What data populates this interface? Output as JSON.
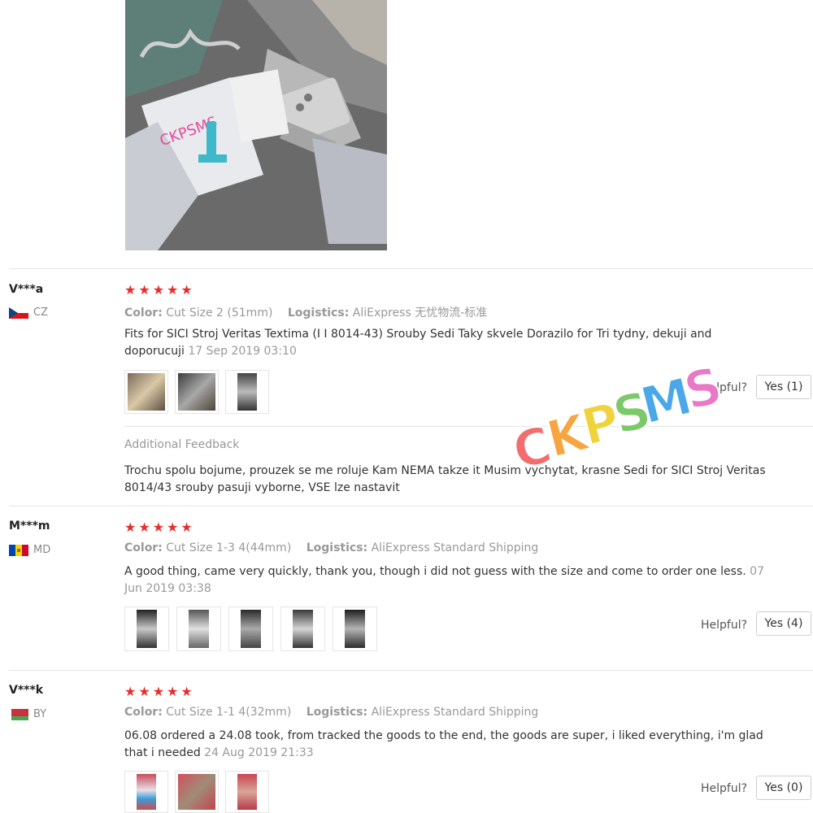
{
  "top_image": {
    "alt_icon": "product-photo"
  },
  "reviews": [
    {
      "user": "V***a",
      "country": "CZ",
      "flag_colors": [
        "#ffffff",
        "#d7141a",
        "#11457e"
      ],
      "stars": 5,
      "color_label": "Color:",
      "color_value": "Cut Size 2 (51mm)",
      "logistics_label": "Logistics:",
      "logistics_value": "AliExpress 无忧物流-标准",
      "text": "Fits for SICI Stroj Veritas Textima (I I 8014-43) Srouby Sedi Taky skvele Dorazilo for Tri tydny, dekuji and doporucuji",
      "date": "17 Sep 2019 03:10",
      "thumb_count": 3,
      "helpful_label": "Helpful?",
      "yes_label": "Yes (1)",
      "additional_title": "Additional Feedback",
      "additional_text": "Trochu spolu bojume, prouzek se me roluje Kam NEMA takze it Musim vychytat, krasne Sedi for SICI Stroj Veritas 8014/43 srouby pasuji vyborne, VSE lze nastavit"
    },
    {
      "user": "M***m",
      "country": "MD",
      "flag_colors": [
        "#0046ae",
        "#ffd200",
        "#cc092f"
      ],
      "stars": 5,
      "color_label": "Color:",
      "color_value": "Cut Size 1-3 4(44mm)",
      "logistics_label": "Logistics:",
      "logistics_value": "AliExpress Standard Shipping",
      "text": "A good thing, came very quickly, thank you, though i did not guess with the size and come to order one less.",
      "date": "07 Jun 2019 03:38",
      "thumb_count": 5,
      "helpful_label": "Helpful?",
      "yes_label": "Yes (4)"
    },
    {
      "user": "V***k",
      "country": "BY",
      "flag_colors": [
        "#c8313e",
        "#4aa657"
      ],
      "stars": 5,
      "color_label": "Color:",
      "color_value": "Cut Size 1-1 4(32mm)",
      "logistics_label": "Logistics:",
      "logistics_value": "AliExpress Standard Shipping",
      "text": "06.08 ordered a 24.08 took, from tracked the goods to the end, the goods are super, i liked everything, i'm glad that i needed",
      "date": "24 Aug 2019 21:33",
      "thumb_count": 3,
      "helpful_label": "Helpful?",
      "yes_label": "Yes (0)"
    }
  ],
  "watermark": {
    "text": "CKPSMS",
    "colors": [
      "#f26d6d",
      "#f7a541",
      "#f0d23c",
      "#7cc96b",
      "#4aa8e8",
      "#e879c7"
    ]
  }
}
